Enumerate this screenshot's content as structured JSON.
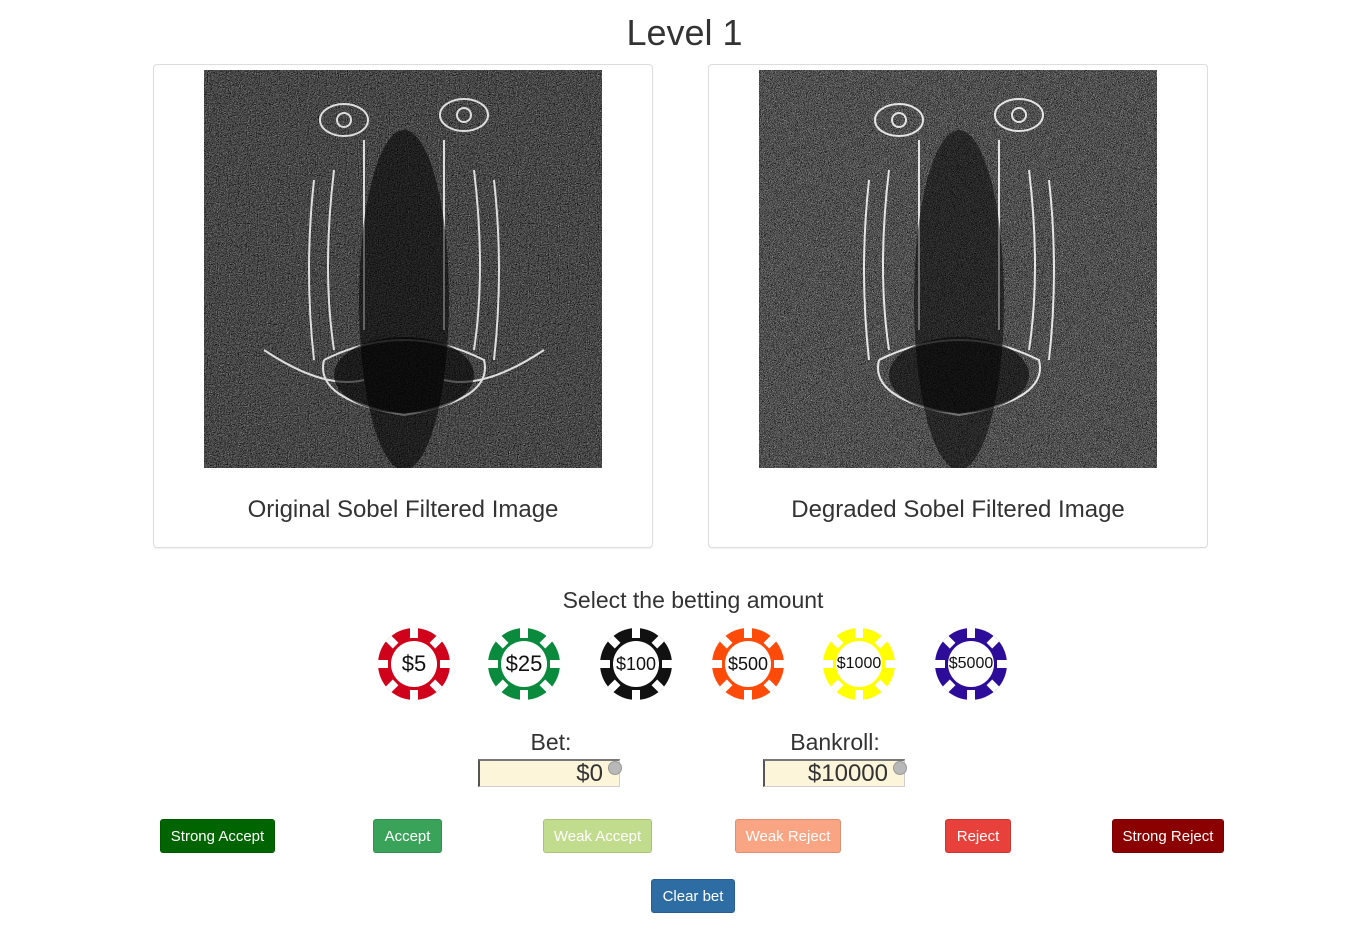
{
  "page": {
    "title": "Level 1"
  },
  "panels": [
    {
      "caption": "Original Sobel Filtered Image"
    },
    {
      "caption": "Degraded Sobel Filtered Image"
    }
  ],
  "betting": {
    "prompt": "Select the betting amount",
    "chips": [
      {
        "label": "$5",
        "color": "#d0021b"
      },
      {
        "label": "$25",
        "color": "#0a8a3d"
      },
      {
        "label": "$100",
        "color": "#111111"
      },
      {
        "label": "$500",
        "color": "#ff4b0a"
      },
      {
        "label": "$1000",
        "color": "#ffff00"
      },
      {
        "label": "$5000",
        "color": "#2e0c9a"
      }
    ]
  },
  "bet": {
    "label": "Bet:",
    "value": "$0"
  },
  "bankroll": {
    "label": "Bankroll:",
    "value": "$10000"
  },
  "decisions": [
    {
      "label": "Strong Accept",
      "color": "#006400"
    },
    {
      "label": "Accept",
      "color": "#3aa35a"
    },
    {
      "label": "Weak Accept",
      "color": "#c2dc8e"
    },
    {
      "label": "Weak Reject",
      "color": "#f9a482"
    },
    {
      "label": "Reject",
      "color": "#e8403a"
    },
    {
      "label": "Strong Reject",
      "color": "#8b0000"
    }
  ],
  "clear_bet": {
    "label": "Clear bet",
    "color": "#2e6da4"
  }
}
